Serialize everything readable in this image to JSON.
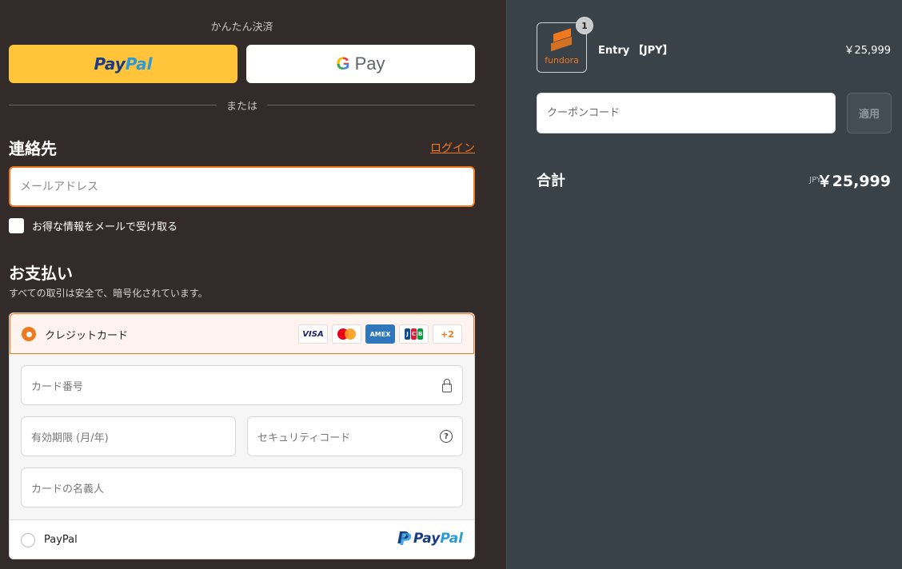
{
  "express": {
    "label": "かんたん決済",
    "paypal_part1": "Pay",
    "paypal_part2": "Pal",
    "gpay_g": "G",
    "gpay_text": "Pay",
    "divider": "または"
  },
  "contact": {
    "title": "連絡先",
    "login": "ログイン",
    "email_placeholder": "メールアドレス",
    "newsletter": "お得な情報をメールで受け取る"
  },
  "payment": {
    "title": "お支払い",
    "subtitle": "すべての取引は安全で、暗号化されています。",
    "credit_card_label": "クレジットカード",
    "brands": {
      "visa": "VISA",
      "amex": "AMEX",
      "more": "+2"
    },
    "card_number_placeholder": "カード番号",
    "expiry_placeholder": "有効期限 (月/年)",
    "cvc_placeholder": "セキュリティコード",
    "name_placeholder": "カードの名義人",
    "paypal_label": "PayPal",
    "paypal_logo_1": "Pay",
    "paypal_logo_2": "Pal"
  },
  "summary": {
    "logo_text": "fundora",
    "quantity": "1",
    "product_name": "Entry 【JPY】",
    "product_price": "￥25,999",
    "coupon_placeholder": "クーポンコード",
    "apply": "適用",
    "total_label": "合計",
    "total_currency": "JPY",
    "total_value": "￥25,999"
  },
  "colors": {
    "accent": "#f0781e",
    "left_bg": "#332b29",
    "right_bg": "#384248",
    "paypal_yellow": "#ffc43a"
  }
}
